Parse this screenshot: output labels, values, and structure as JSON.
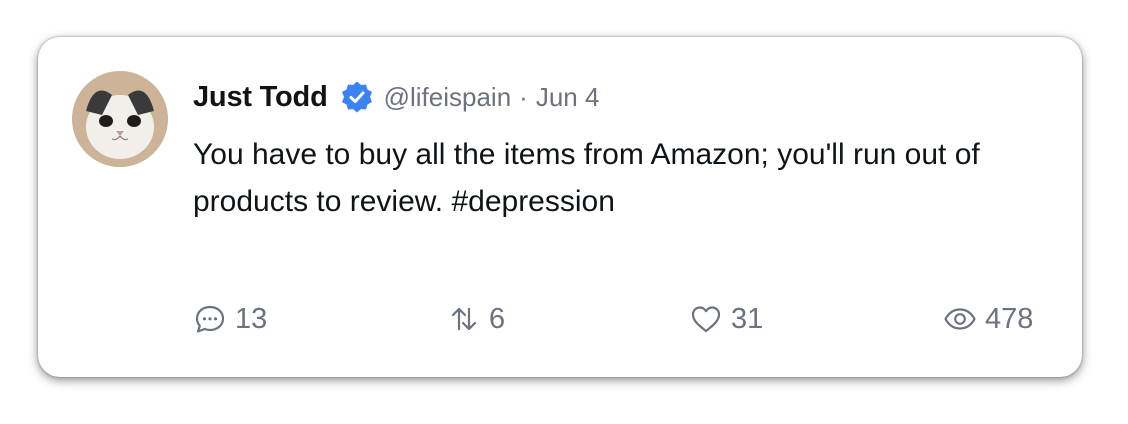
{
  "post": {
    "author_name": "Just Todd",
    "verified_icon": "verified-badge-icon",
    "handle": "@lifeispain",
    "separator": "·",
    "date": "Jun 4",
    "text": "You have to buy all the items from Amazon; you'll run out of products to review. #depression"
  },
  "actions": {
    "replies": "13",
    "reposts": "6",
    "likes": "31",
    "views": "478"
  },
  "colors": {
    "verified": "#3b82f6",
    "muted": "#6b7280",
    "text": "#0f1419"
  }
}
